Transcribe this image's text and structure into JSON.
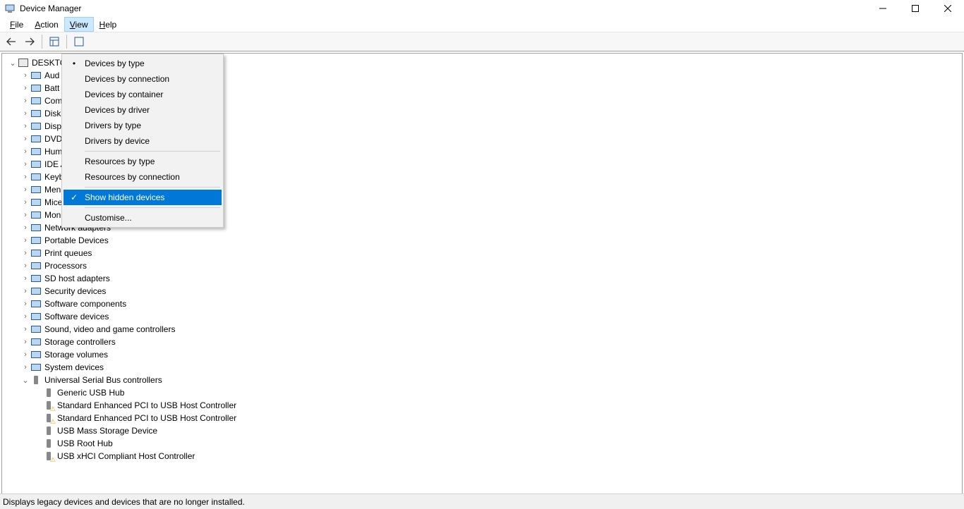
{
  "title": "Device Manager",
  "menubar": {
    "file": "File",
    "action": "Action",
    "view": "View",
    "help": "Help"
  },
  "view_menu": {
    "devices_by_type": "Devices by type",
    "devices_by_connection": "Devices by connection",
    "devices_by_container": "Devices by container",
    "devices_by_driver": "Devices by driver",
    "drivers_by_type": "Drivers by type",
    "drivers_by_device": "Drivers by device",
    "resources_by_type": "Resources by type",
    "resources_by_connection": "Resources by connection",
    "show_hidden": "Show hidden devices",
    "customise": "Customise...",
    "selected": "devices_by_type",
    "highlighted": "show_hidden",
    "show_hidden_checked": true
  },
  "tree": {
    "root": "DESKTO",
    "categories": [
      "Aud",
      "Batt",
      "Com",
      "Disk",
      "Disp",
      "DVD",
      "Hum",
      "IDE A",
      "Keyb",
      "Men",
      "Mice",
      "Monitors",
      "Network adapters",
      "Portable Devices",
      "Print queues",
      "Processors",
      "SD host adapters",
      "Security devices",
      "Software components",
      "Software devices",
      "Sound, video and game controllers",
      "Storage controllers",
      "Storage volumes",
      "System devices"
    ],
    "usb": {
      "label": "Universal Serial Bus controllers",
      "children": [
        {
          "label": "Generic USB Hub",
          "warn": false
        },
        {
          "label": "Standard Enhanced PCI to USB Host Controller",
          "warn": true
        },
        {
          "label": "Standard Enhanced PCI to USB Host Controller",
          "warn": true
        },
        {
          "label": "USB Mass Storage Device",
          "warn": false
        },
        {
          "label": "USB Root Hub",
          "warn": false
        },
        {
          "label": "USB xHCI Compliant Host Controller",
          "warn": true
        }
      ]
    }
  },
  "status": "Displays legacy devices and devices that are no longer installed."
}
